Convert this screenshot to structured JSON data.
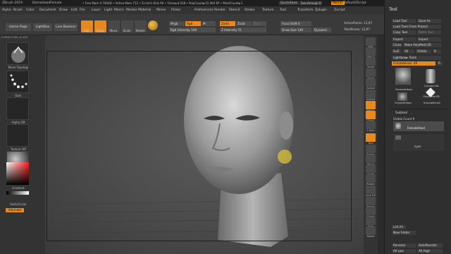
{
  "titlebar": {
    "app": "ZBrush 2019",
    "document": "DemoHeadFemale",
    "stats": "• Free Mem 0.794GB • Active Mem 712 • Scratch Disk 90 • Timer►0.028 • PolyCount►15.064 KP • MeshCount►1",
    "quicksave": "QuickSave",
    "seethrough": "See-through   0",
    "menus_label": "Menus",
    "defaultscript": "DefaultZScript"
  },
  "menubar": [
    "Alpha",
    "Brush",
    "Color",
    "Document",
    "Draw",
    "Edit",
    "File",
    "Layer",
    "Light",
    "Macro",
    "Marker",
    "Material",
    "Movie",
    "Picker",
    "Preferences",
    "Render",
    "Stencil",
    "Stroke",
    "Texture",
    "Tool",
    "Transform",
    "Zplugin",
    "Zscript"
  ],
  "toptool": {
    "home_page": "Home Page",
    "lightbox": "LightBox",
    "live_boolean": "Live Boolean",
    "tools": [
      "Edit",
      "Draw",
      "Move",
      "Scale",
      "Rotate"
    ],
    "mrgb": "Mrgb",
    "rgb": "Rgb",
    "m": "M",
    "zadd": "Zadd",
    "zsub": "Zsub",
    "zcut": "Zcut",
    "rgb_intensity": "Rgb Intensity 100",
    "z_intensity": "Z Intensity 51",
    "focal_shift": "Focal Shift 0",
    "draw_size": "Draw Size 140",
    "dynamic": "Dynamic",
    "active_points": "ActivePoints: 12,97",
    "total_points": "TotalPoints: 12,97"
  },
  "coords": "-0.394,0.192,-0.419",
  "leftshelf": {
    "brush_label": "Move Topologi",
    "stroke_label": "Dots",
    "alpha_label": "Alpha Off",
    "texture_label": "Texture Off",
    "material_label": "MatCap Gray",
    "gradient_label": "Gradient",
    "switch_color_label": "SwitchColor",
    "alternate_label": "Alternate"
  },
  "rightshelf": [
    "BPR",
    "SPix 3",
    "Scroll",
    "Zoom",
    "Actual",
    "AAHalf",
    "Persp",
    "Floor",
    "L.Sym",
    "Xyz",
    "Frame",
    "Move",
    "Scale",
    "Rotate",
    "Line Fill PolyF",
    "Transp",
    "Ghost",
    "Solo",
    "Xpose"
  ],
  "toolpanel": {
    "title": "Tool",
    "load_tool": "Load Tool",
    "save_as": "Save As",
    "load_from_project": "Load Tools From Project",
    "copy_tool": "Copy Tool",
    "paste_tool": "Paste Tool",
    "import": "Import",
    "export": "Export",
    "clone": "Clone",
    "make_polymesh": "Make PolyMesh3D",
    "goz": "GoZ",
    "all": "All",
    "visible": "Visible",
    "r": "R",
    "lightbox_tools": "Lightbox► Tools",
    "current_tool": "FemaleHead. 48",
    "r2": "R",
    "thumbs": [
      "FemaleHead",
      "Cylinder3D",
      "PolyMesh3D",
      "FemaleHead",
      "SimpleBrush"
    ],
    "thumb_counts": [
      "2",
      "",
      ""
    ],
    "subtool_header": "Subtool",
    "visible_count": "Visible Count 9",
    "subtool_items": [
      "FemaleHead",
      "eyes"
    ],
    "list_all": "List All",
    "new_folder": "New Folder",
    "rename": "Rename",
    "autoreorder": "AutoReorder",
    "all_low": "All Low",
    "all_high": "All High"
  },
  "colors": {
    "accent": "#e8891d",
    "panel_bg": "#2f2f2f",
    "viewport": "#4e4e4e",
    "cursor_yellow": "#d9c23b"
  }
}
